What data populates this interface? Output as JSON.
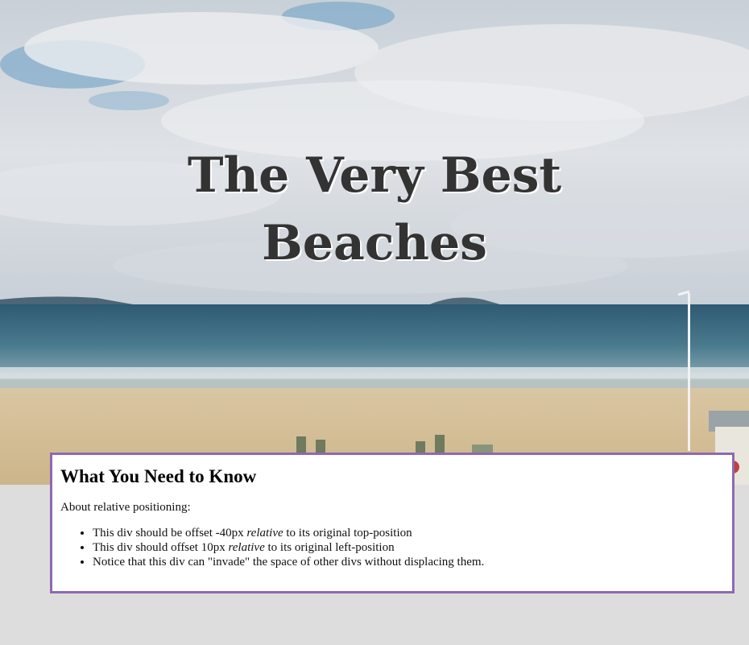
{
  "hero": {
    "title_line1": "The Very Best",
    "title_line2": "Beaches"
  },
  "info": {
    "heading": "What You Need to Know",
    "intro": "About relative positioning:",
    "items": [
      {
        "before": "This div should be offset -40px ",
        "emph": "relative",
        "after": " to its original top-position"
      },
      {
        "before": "This div should offset 10px ",
        "emph": "relative",
        "after": " to its original left-position"
      },
      {
        "before": "Notice that this div can \"invade\" the space of other divs without displacing them.",
        "emph": "",
        "after": ""
      }
    ]
  },
  "colors": {
    "page_background": "#dddddd",
    "box_border": "#8f68b4",
    "title_text": "#333333"
  }
}
